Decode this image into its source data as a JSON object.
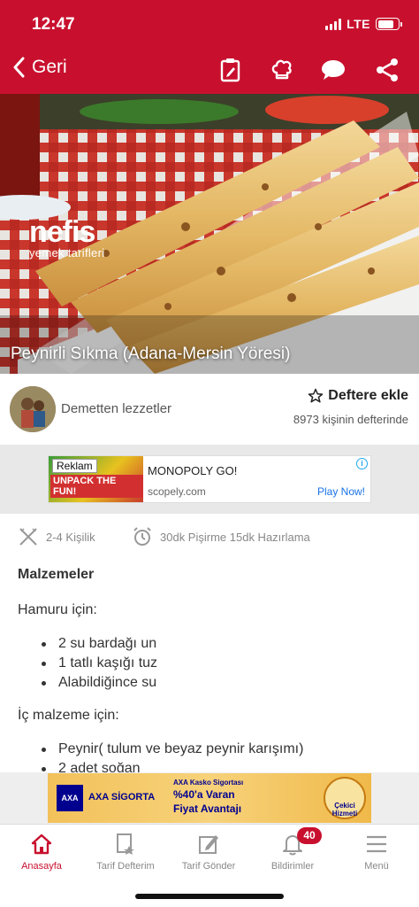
{
  "status_bar": {
    "time": "12:47",
    "network": "LTE"
  },
  "nav": {
    "back_label": "Geri"
  },
  "hero": {
    "logo_main": "nefis",
    "logo_sub": "yemek tarifleri",
    "recipe_title": "Peynirli Sıkma (Adana-Mersin Yöresi)"
  },
  "author": {
    "name": "Demetten lezzetler",
    "add_label": "Deftere ekle",
    "saved_count_text": "8973 kişinin defterinde"
  },
  "ad": {
    "badge": "Reklam",
    "image_caption": "UNPACK THE FUN!",
    "title": "MONOPOLY GO!",
    "url": "scopely.com",
    "cta": "Play Now!"
  },
  "meta": {
    "servings": "2-4  Kişilik",
    "time": "30dk Pişirme 15dk Hazırlama"
  },
  "content": {
    "section_title": "Malzemeler",
    "groups": [
      {
        "title": "Hamuru için:",
        "items": [
          "2 su bardağı un",
          "1 tatlı kaşığı tuz",
          "Alabildiğince su"
        ]
      },
      {
        "title": "İç malzeme için:",
        "items": [
          "Peynir( tulum ve beyaz peynir karışımı)",
          "2  adet soğan"
        ]
      }
    ]
  },
  "bottom_ad": {
    "brand": "AXA SİGORTA",
    "promo_line1": "AXA Kasko Sigortası",
    "promo_line2": "%40'a Varan",
    "promo_line3": "Fiyat Avantajı",
    "badge_text": "Çekici Hizmeti"
  },
  "tabs": [
    {
      "label": "Anasayfa"
    },
    {
      "label": "Tarif Defterim"
    },
    {
      "label": "Tarif Gönder"
    },
    {
      "label": "Bildirimler"
    },
    {
      "label": "Menü"
    }
  ],
  "notifications_count": "40",
  "colors": {
    "brand_red": "#c8102e",
    "muted_gray": "#888888"
  },
  "icons": [
    "chevron-left-icon",
    "clipboard-edit-icon",
    "chef-hat-icon",
    "chat-bubble-icon",
    "share-icon",
    "star-outline-icon",
    "utensils-icon",
    "alarm-clock-icon",
    "home-icon",
    "notebook-icon",
    "send-recipe-icon",
    "bell-icon",
    "hamburger-menu-icon",
    "info-icon"
  ]
}
